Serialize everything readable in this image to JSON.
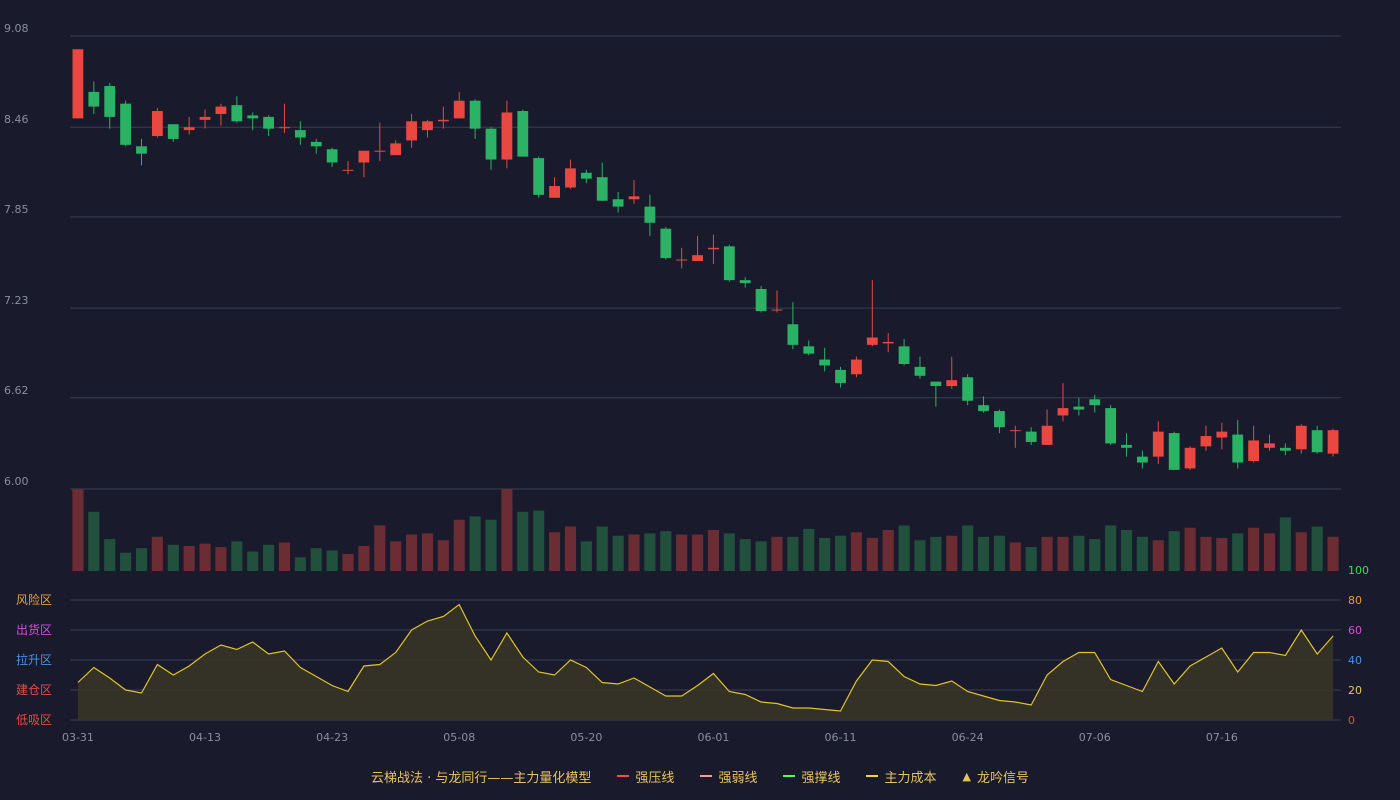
{
  "colors": {
    "background": "#191b2d",
    "up": "#e8483f",
    "down": "#2bb264",
    "up_volume": "#6b2c34",
    "down_volume": "#21503d",
    "grid": "#3a3d52",
    "axis_text": "#8a8d9c",
    "oscillator_line": "#e0c32a",
    "oscillator_fill": "#3a3526",
    "accent_gold": "#e8c35a"
  },
  "chart_data": {
    "type": "candlestick",
    "price_axis": {
      "ticks": [
        "9.08",
        "8.46",
        "7.85",
        "7.23",
        "6.62",
        "6.00"
      ],
      "ylim": [
        6.0,
        9.08
      ]
    },
    "x_tick_labels": [
      "03-31",
      "04-13",
      "04-23",
      "05-08",
      "05-20",
      "06-01",
      "06-11",
      "06-24",
      "07-06",
      "07-16"
    ],
    "x_tick_indices": [
      0,
      8,
      16,
      24,
      32,
      40,
      48,
      56,
      64,
      72
    ],
    "candles": [
      [
        8.52,
        8.99,
        8.52,
        8.99
      ],
      [
        8.7,
        8.6,
        8.55,
        8.77
      ],
      [
        8.74,
        8.53,
        8.45,
        8.76
      ],
      [
        8.62,
        8.34,
        8.33,
        8.64
      ],
      [
        8.33,
        8.28,
        8.2,
        8.38
      ],
      [
        8.4,
        8.57,
        8.39,
        8.59
      ],
      [
        8.48,
        8.38,
        8.36,
        8.48
      ],
      [
        8.44,
        8.46,
        8.41,
        8.53
      ],
      [
        8.51,
        8.53,
        8.45,
        8.58
      ],
      [
        8.55,
        8.6,
        8.47,
        8.62
      ],
      [
        8.61,
        8.5,
        8.49,
        8.67
      ],
      [
        8.54,
        8.52,
        8.44,
        8.56
      ],
      [
        8.53,
        8.45,
        8.4,
        8.54
      ],
      [
        8.46,
        8.46,
        8.42,
        8.62
      ],
      [
        8.44,
        8.39,
        8.34,
        8.5
      ],
      [
        8.36,
        8.33,
        8.28,
        8.38
      ],
      [
        8.31,
        8.22,
        8.19,
        8.32
      ],
      [
        8.17,
        8.17,
        8.14,
        8.23
      ],
      [
        8.22,
        8.3,
        8.12,
        8.3
      ],
      [
        8.3,
        8.3,
        8.23,
        8.49
      ],
      [
        8.27,
        8.35,
        8.27,
        8.37
      ],
      [
        8.37,
        8.5,
        8.32,
        8.55
      ],
      [
        8.44,
        8.5,
        8.39,
        8.51
      ],
      [
        8.5,
        8.51,
        8.45,
        8.6
      ],
      [
        8.52,
        8.64,
        8.52,
        8.7
      ],
      [
        8.64,
        8.45,
        8.38,
        8.65
      ],
      [
        8.45,
        8.24,
        8.17,
        8.46
      ],
      [
        8.24,
        8.56,
        8.18,
        8.64
      ],
      [
        8.57,
        8.26,
        8.26,
        8.58
      ],
      [
        8.25,
        8.0,
        7.98,
        8.26
      ],
      [
        7.98,
        8.06,
        7.98,
        8.12
      ],
      [
        8.05,
        8.18,
        8.04,
        8.24
      ],
      [
        8.15,
        8.11,
        8.08,
        8.17
      ],
      [
        8.12,
        7.96,
        7.96,
        8.22
      ],
      [
        7.97,
        7.92,
        7.88,
        8.02
      ],
      [
        7.97,
        7.99,
        7.94,
        8.1
      ],
      [
        7.92,
        7.81,
        7.72,
        8.0
      ],
      [
        7.77,
        7.57,
        7.56,
        7.78
      ],
      [
        7.56,
        7.56,
        7.5,
        7.64
      ],
      [
        7.55,
        7.59,
        7.55,
        7.72
      ],
      [
        7.63,
        7.64,
        7.53,
        7.73
      ],
      [
        7.65,
        7.42,
        7.41,
        7.66
      ],
      [
        7.42,
        7.4,
        7.37,
        7.44
      ],
      [
        7.36,
        7.21,
        7.2,
        7.38
      ],
      [
        7.22,
        7.22,
        7.2,
        7.35
      ],
      [
        7.12,
        6.98,
        6.95,
        7.27
      ],
      [
        6.97,
        6.92,
        6.91,
        7.01
      ],
      [
        6.88,
        6.84,
        6.8,
        6.96
      ],
      [
        6.81,
        6.72,
        6.69,
        6.83
      ],
      [
        6.78,
        6.88,
        6.76,
        6.9
      ],
      [
        6.98,
        7.03,
        6.97,
        7.42
      ],
      [
        6.99,
        7.0,
        6.93,
        7.06
      ],
      [
        6.97,
        6.85,
        6.84,
        7.02
      ],
      [
        6.83,
        6.77,
        6.75,
        6.9
      ],
      [
        6.73,
        6.7,
        6.56,
        6.71
      ],
      [
        6.7,
        6.74,
        6.68,
        6.9
      ],
      [
        6.76,
        6.6,
        6.57,
        6.78
      ],
      [
        6.57,
        6.53,
        6.52,
        6.63
      ],
      [
        6.53,
        6.42,
        6.38,
        6.54
      ],
      [
        6.4,
        6.4,
        6.28,
        6.43
      ],
      [
        6.39,
        6.32,
        6.3,
        6.42
      ],
      [
        6.3,
        6.43,
        6.3,
        6.54
      ],
      [
        6.5,
        6.55,
        6.46,
        6.72
      ],
      [
        6.56,
        6.54,
        6.5,
        6.62
      ],
      [
        6.61,
        6.57,
        6.52,
        6.64
      ],
      [
        6.55,
        6.31,
        6.3,
        6.57
      ],
      [
        6.3,
        6.28,
        6.22,
        6.38
      ],
      [
        6.22,
        6.18,
        6.14,
        6.26
      ],
      [
        6.22,
        6.39,
        6.17,
        6.46
      ],
      [
        6.38,
        6.13,
        6.13,
        6.39
      ],
      [
        6.14,
        6.28,
        6.13,
        6.29
      ],
      [
        6.29,
        6.36,
        6.26,
        6.43
      ],
      [
        6.35,
        6.39,
        6.27,
        6.45
      ],
      [
        6.37,
        6.18,
        6.14,
        6.47
      ],
      [
        6.19,
        6.33,
        6.18,
        6.43
      ],
      [
        6.28,
        6.31,
        6.26,
        6.37
      ],
      [
        6.28,
        6.26,
        6.23,
        6.31
      ],
      [
        6.27,
        6.43,
        6.24,
        6.44
      ],
      [
        6.4,
        6.25,
        6.24,
        6.43
      ],
      [
        6.24,
        6.4,
        6.22,
        6.41
      ]
    ],
    "volume": [
      72,
      52,
      28,
      16,
      20,
      30,
      23,
      22,
      24,
      21,
      26,
      17,
      23,
      25,
      12,
      20,
      18,
      15,
      22,
      40,
      26,
      32,
      33,
      27,
      45,
      48,
      45,
      72,
      52,
      53,
      34,
      39,
      26,
      39,
      31,
      32,
      33,
      35,
      32,
      32,
      36,
      33,
      28,
      26,
      30,
      30,
      37,
      29,
      31,
      34,
      29,
      36,
      40,
      27,
      30,
      31,
      40,
      30,
      31,
      25,
      21,
      30,
      30,
      31,
      28,
      40,
      36,
      30,
      27,
      35,
      38,
      30,
      29,
      33,
      38,
      33,
      47,
      34,
      39,
      30
    ],
    "oscillator": {
      "ylim": [
        0,
        100
      ],
      "ticks": [
        "100",
        "80",
        "60",
        "40",
        "20",
        "0"
      ],
      "zones": [
        "风险区",
        "出货区",
        "拉升区",
        "建仓区",
        "低吸区"
      ],
      "values": [
        25,
        35,
        28,
        20,
        18,
        37,
        30,
        36,
        44,
        50,
        47,
        52,
        44,
        46,
        35,
        29,
        23,
        19,
        36,
        37,
        45,
        60,
        66,
        69,
        77,
        56,
        40,
        58,
        42,
        32,
        30,
        40,
        35,
        25,
        24,
        28,
        22,
        16,
        16,
        23,
        31,
        19,
        17,
        12,
        11,
        8,
        8,
        7,
        6,
        26,
        40,
        39,
        29,
        24,
        23,
        26,
        19,
        16,
        13,
        12,
        10,
        30,
        39,
        45,
        45,
        27,
        23,
        19,
        39,
        24,
        36,
        42,
        48,
        32,
        45,
        45,
        43,
        60,
        44,
        56
      ]
    },
    "legend": [
      {
        "label": "云梯战法 · 与龙同行——主力量化模型",
        "style": "text"
      },
      {
        "label": "强压线",
        "color": "#ff4a4a",
        "style": "solid"
      },
      {
        "label": "强弱线",
        "color": "#ff9999",
        "style": "dashed"
      },
      {
        "label": "强撑线",
        "color": "#4cff5a",
        "style": "solid"
      },
      {
        "label": "主力成本",
        "color": "#f4d03f",
        "style": "dashed"
      },
      {
        "label": "龙吟信号",
        "color": "#e8c35a",
        "style": "triangle"
      }
    ]
  }
}
